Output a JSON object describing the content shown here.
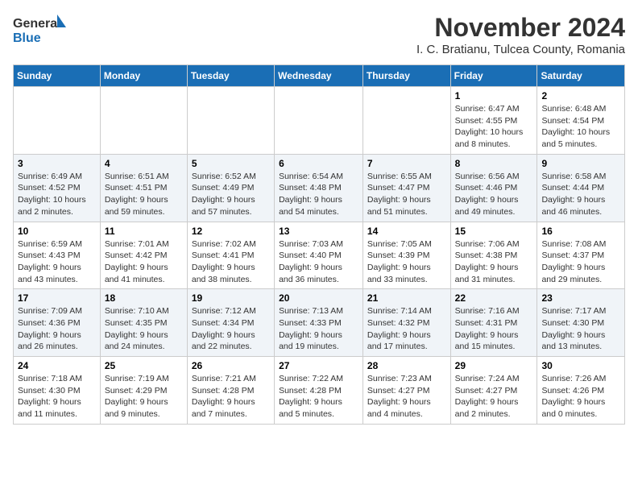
{
  "header": {
    "logo_general": "General",
    "logo_blue": "Blue",
    "month_title": "November 2024",
    "location": "I. C. Bratianu, Tulcea County, Romania"
  },
  "days_of_week": [
    "Sunday",
    "Monday",
    "Tuesday",
    "Wednesday",
    "Thursday",
    "Friday",
    "Saturday"
  ],
  "weeks": [
    [
      {
        "day": "",
        "info": ""
      },
      {
        "day": "",
        "info": ""
      },
      {
        "day": "",
        "info": ""
      },
      {
        "day": "",
        "info": ""
      },
      {
        "day": "",
        "info": ""
      },
      {
        "day": "1",
        "info": "Sunrise: 6:47 AM\nSunset: 4:55 PM\nDaylight: 10 hours and 8 minutes."
      },
      {
        "day": "2",
        "info": "Sunrise: 6:48 AM\nSunset: 4:54 PM\nDaylight: 10 hours and 5 minutes."
      }
    ],
    [
      {
        "day": "3",
        "info": "Sunrise: 6:49 AM\nSunset: 4:52 PM\nDaylight: 10 hours and 2 minutes."
      },
      {
        "day": "4",
        "info": "Sunrise: 6:51 AM\nSunset: 4:51 PM\nDaylight: 9 hours and 59 minutes."
      },
      {
        "day": "5",
        "info": "Sunrise: 6:52 AM\nSunset: 4:49 PM\nDaylight: 9 hours and 57 minutes."
      },
      {
        "day": "6",
        "info": "Sunrise: 6:54 AM\nSunset: 4:48 PM\nDaylight: 9 hours and 54 minutes."
      },
      {
        "day": "7",
        "info": "Sunrise: 6:55 AM\nSunset: 4:47 PM\nDaylight: 9 hours and 51 minutes."
      },
      {
        "day": "8",
        "info": "Sunrise: 6:56 AM\nSunset: 4:46 PM\nDaylight: 9 hours and 49 minutes."
      },
      {
        "day": "9",
        "info": "Sunrise: 6:58 AM\nSunset: 4:44 PM\nDaylight: 9 hours and 46 minutes."
      }
    ],
    [
      {
        "day": "10",
        "info": "Sunrise: 6:59 AM\nSunset: 4:43 PM\nDaylight: 9 hours and 43 minutes."
      },
      {
        "day": "11",
        "info": "Sunrise: 7:01 AM\nSunset: 4:42 PM\nDaylight: 9 hours and 41 minutes."
      },
      {
        "day": "12",
        "info": "Sunrise: 7:02 AM\nSunset: 4:41 PM\nDaylight: 9 hours and 38 minutes."
      },
      {
        "day": "13",
        "info": "Sunrise: 7:03 AM\nSunset: 4:40 PM\nDaylight: 9 hours and 36 minutes."
      },
      {
        "day": "14",
        "info": "Sunrise: 7:05 AM\nSunset: 4:39 PM\nDaylight: 9 hours and 33 minutes."
      },
      {
        "day": "15",
        "info": "Sunrise: 7:06 AM\nSunset: 4:38 PM\nDaylight: 9 hours and 31 minutes."
      },
      {
        "day": "16",
        "info": "Sunrise: 7:08 AM\nSunset: 4:37 PM\nDaylight: 9 hours and 29 minutes."
      }
    ],
    [
      {
        "day": "17",
        "info": "Sunrise: 7:09 AM\nSunset: 4:36 PM\nDaylight: 9 hours and 26 minutes."
      },
      {
        "day": "18",
        "info": "Sunrise: 7:10 AM\nSunset: 4:35 PM\nDaylight: 9 hours and 24 minutes."
      },
      {
        "day": "19",
        "info": "Sunrise: 7:12 AM\nSunset: 4:34 PM\nDaylight: 9 hours and 22 minutes."
      },
      {
        "day": "20",
        "info": "Sunrise: 7:13 AM\nSunset: 4:33 PM\nDaylight: 9 hours and 19 minutes."
      },
      {
        "day": "21",
        "info": "Sunrise: 7:14 AM\nSunset: 4:32 PM\nDaylight: 9 hours and 17 minutes."
      },
      {
        "day": "22",
        "info": "Sunrise: 7:16 AM\nSunset: 4:31 PM\nDaylight: 9 hours and 15 minutes."
      },
      {
        "day": "23",
        "info": "Sunrise: 7:17 AM\nSunset: 4:30 PM\nDaylight: 9 hours and 13 minutes."
      }
    ],
    [
      {
        "day": "24",
        "info": "Sunrise: 7:18 AM\nSunset: 4:30 PM\nDaylight: 9 hours and 11 minutes."
      },
      {
        "day": "25",
        "info": "Sunrise: 7:19 AM\nSunset: 4:29 PM\nDaylight: 9 hours and 9 minutes."
      },
      {
        "day": "26",
        "info": "Sunrise: 7:21 AM\nSunset: 4:28 PM\nDaylight: 9 hours and 7 minutes."
      },
      {
        "day": "27",
        "info": "Sunrise: 7:22 AM\nSunset: 4:28 PM\nDaylight: 9 hours and 5 minutes."
      },
      {
        "day": "28",
        "info": "Sunrise: 7:23 AM\nSunset: 4:27 PM\nDaylight: 9 hours and 4 minutes."
      },
      {
        "day": "29",
        "info": "Sunrise: 7:24 AM\nSunset: 4:27 PM\nDaylight: 9 hours and 2 minutes."
      },
      {
        "day": "30",
        "info": "Sunrise: 7:26 AM\nSunset: 4:26 PM\nDaylight: 9 hours and 0 minutes."
      }
    ]
  ]
}
